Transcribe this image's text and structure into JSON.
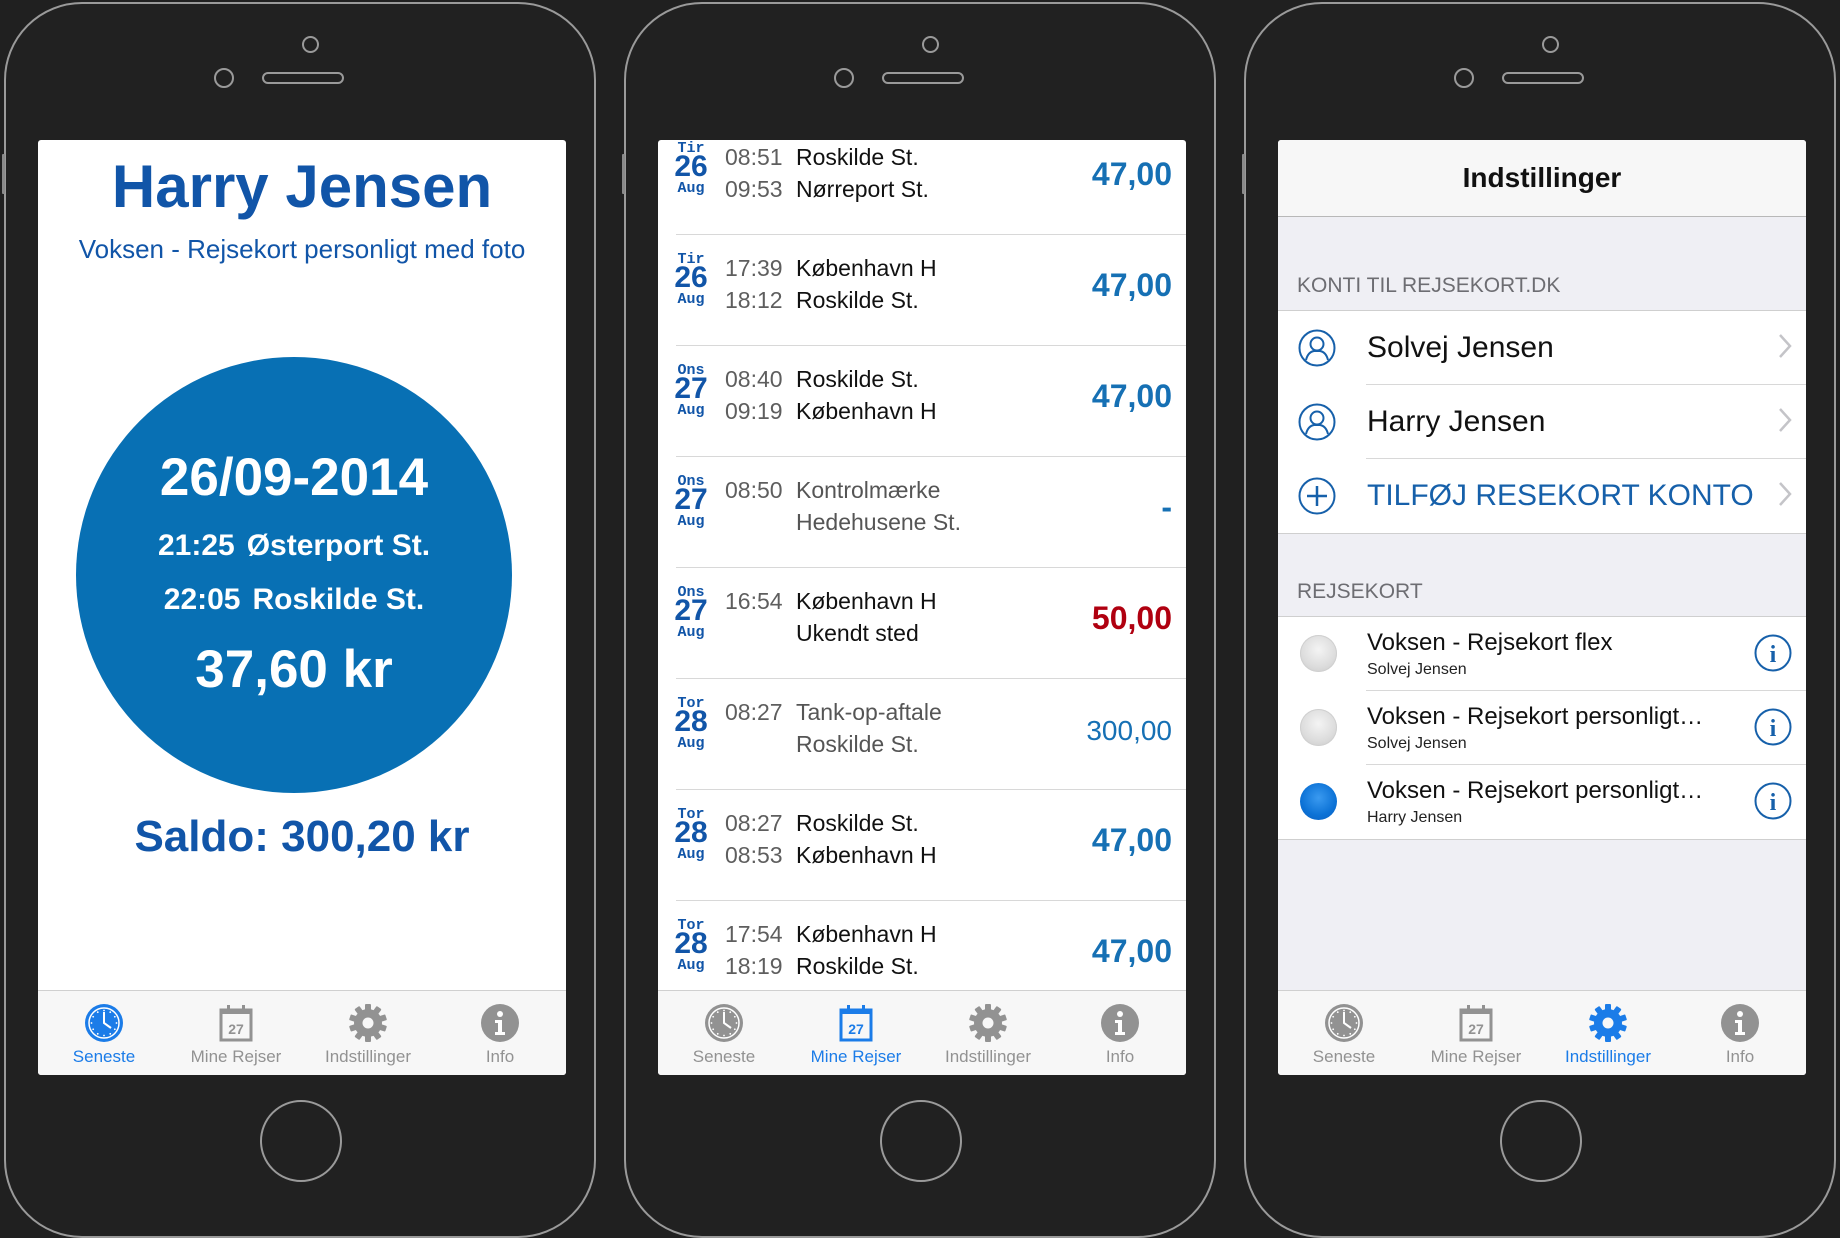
{
  "tabs": [
    {
      "label": "Seneste",
      "icon": "clock-icon"
    },
    {
      "label": "Mine Rejser",
      "icon": "calendar-icon",
      "calendar_day": "27"
    },
    {
      "label": "Indstillinger",
      "icon": "gear-icon"
    },
    {
      "label": "Info",
      "icon": "info-icon"
    }
  ],
  "colors": {
    "accent": "#1b7ce8",
    "brand_blue": "#1155a8",
    "circle_blue": "#0870b4",
    "negative_red": "#b00010",
    "inactive": "#929292"
  },
  "screen1": {
    "active_tab": 0,
    "name": "Harry Jensen",
    "card_type": "Voksen - Rejsekort personligt med foto",
    "latest_trip": {
      "date": "26/09-2014",
      "check_in_time": "21:25",
      "check_in_station": "Østerport St.",
      "check_out_time": "22:05",
      "check_out_station": "Roskilde St.",
      "price": "37,60 kr"
    },
    "balance": "Saldo: 300,20 kr"
  },
  "screen2": {
    "active_tab": 1,
    "trips": [
      {
        "dow": "Tir",
        "day": "26",
        "month": "Aug",
        "t1": "08:51",
        "s1": "Roskilde St.",
        "t2": "09:53",
        "s2": "Nørreport St.",
        "amount": "47,00",
        "style": "normal"
      },
      {
        "dow": "Tir",
        "day": "26",
        "month": "Aug",
        "t1": "17:39",
        "s1": "København H",
        "t2": "18:12",
        "s2": "Roskilde St.",
        "amount": "47,00",
        "style": "normal"
      },
      {
        "dow": "Ons",
        "day": "27",
        "month": "Aug",
        "t1": "08:40",
        "s1": "Roskilde St.",
        "t2": "09:19",
        "s2": "København H",
        "amount": "47,00",
        "style": "normal"
      },
      {
        "dow": "Ons",
        "day": "27",
        "month": "Aug",
        "t1": "08:50",
        "s1": "Kontrolmærke",
        "t2": "",
        "s2": "Hedehusene St.",
        "amount": "-",
        "style": "muted"
      },
      {
        "dow": "Ons",
        "day": "27",
        "month": "Aug",
        "t1": "16:54",
        "s1": "København H",
        "t2": "",
        "s2": "Ukendt sted",
        "amount": "50,00",
        "style": "red"
      },
      {
        "dow": "Tor",
        "day": "28",
        "month": "Aug",
        "t1": "08:27",
        "s1": "Tank-op-aftale",
        "t2": "",
        "s2": "Roskilde St.",
        "amount": "300,00",
        "style": "topup"
      },
      {
        "dow": "Tor",
        "day": "28",
        "month": "Aug",
        "t1": "08:27",
        "s1": "Roskilde St.",
        "t2": "08:53",
        "s2": "København H",
        "amount": "47,00",
        "style": "normal"
      },
      {
        "dow": "Tor",
        "day": "28",
        "month": "Aug",
        "t1": "17:54",
        "s1": "København H",
        "t2": "18:19",
        "s2": "Roskilde St.",
        "amount": "47,00",
        "style": "normal"
      }
    ]
  },
  "screen3": {
    "active_tab": 2,
    "nav_title": "Indstillinger",
    "accounts_header": "KONTI TIL REJSEKORT.DK",
    "accounts": [
      {
        "label": "Solvej Jensen",
        "icon": "person-icon"
      },
      {
        "label": "Harry Jensen",
        "icon": "person-icon"
      },
      {
        "label": "TILFØJ RESEKORT KONTO",
        "icon": "plus-icon"
      }
    ],
    "cards_header": "REJSEKORT",
    "cards": [
      {
        "title": "Voksen - Rejsekort flex",
        "owner": "Solvej Jensen",
        "selected": false
      },
      {
        "title": "Voksen - Rejsekort personligt…",
        "owner": "Solvej Jensen",
        "selected": false
      },
      {
        "title": "Voksen - Rejsekort personligt…",
        "owner": "Harry Jensen",
        "selected": true
      }
    ]
  }
}
